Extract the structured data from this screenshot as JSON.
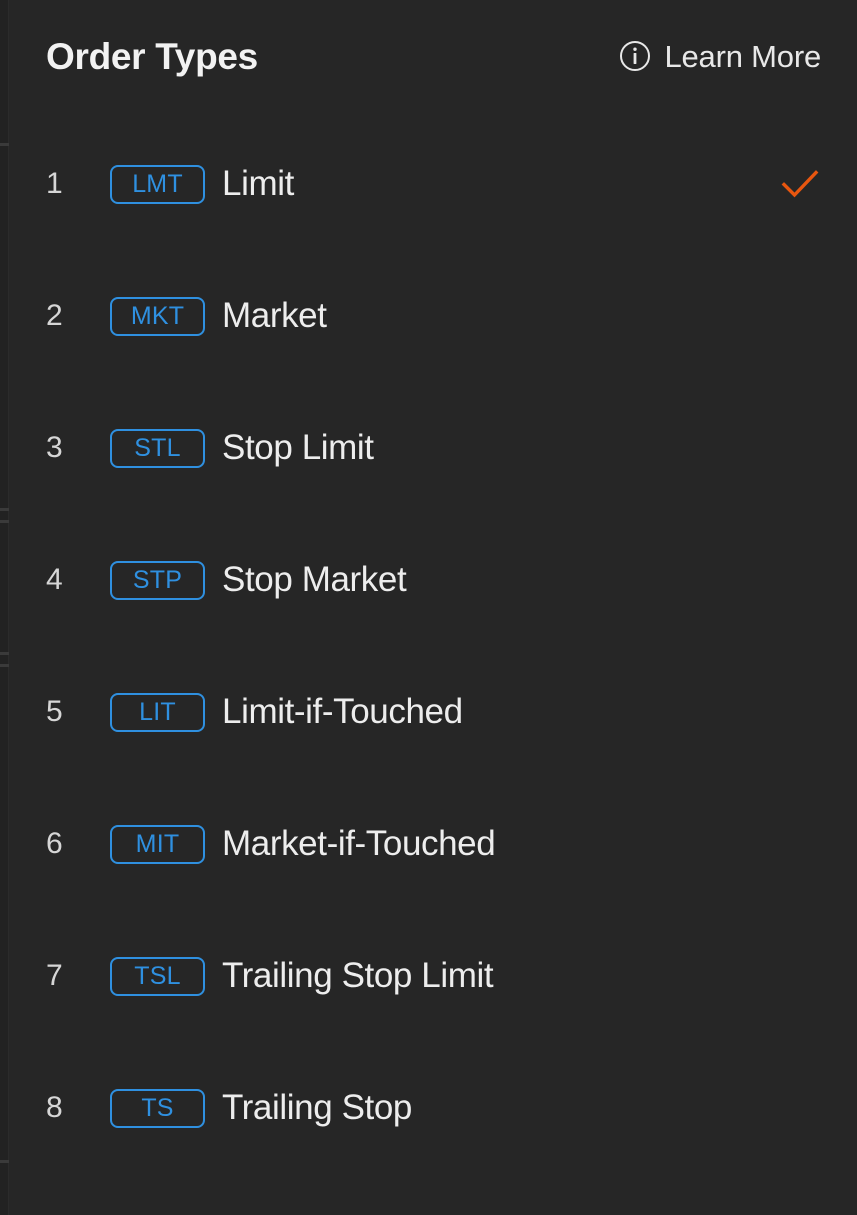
{
  "colors": {
    "background": "#262626",
    "badge_blue": "#2f90e0",
    "check_orange": "#e8560f",
    "primary_text": "#ededed",
    "index_text": "#d6d6d6"
  },
  "header": {
    "title": "Order Types",
    "learn_more_label": "Learn More",
    "info_icon": "info-circle-icon"
  },
  "list": {
    "rows": [
      {
        "index": "1",
        "code": "LMT",
        "label": "Limit",
        "selected": true
      },
      {
        "index": "2",
        "code": "MKT",
        "label": "Market",
        "selected": false
      },
      {
        "index": "3",
        "code": "STL",
        "label": "Stop Limit",
        "selected": false
      },
      {
        "index": "4",
        "code": "STP",
        "label": "Stop Market",
        "selected": false
      },
      {
        "index": "5",
        "code": "LIT",
        "label": "Limit-if-Touched",
        "selected": false
      },
      {
        "index": "6",
        "code": "MIT",
        "label": "Market-if-Touched",
        "selected": false
      },
      {
        "index": "7",
        "code": "TSL",
        "label": "Trailing Stop Limit",
        "selected": false
      },
      {
        "index": "8",
        "code": "TS",
        "label": "Trailing Stop",
        "selected": false
      }
    ],
    "selected_icon": "checkmark-icon"
  }
}
